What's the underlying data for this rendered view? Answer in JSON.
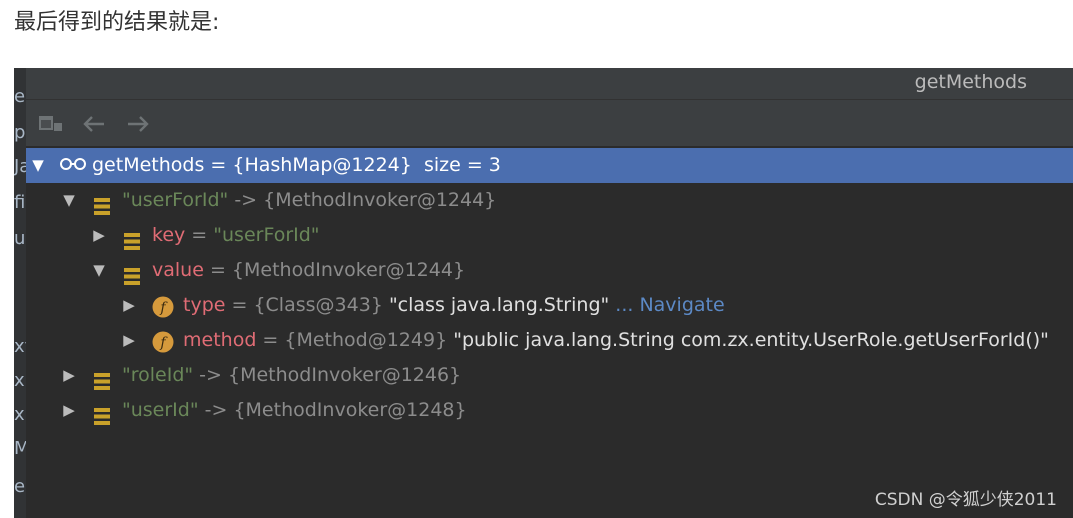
{
  "heading": "最后得到的结果就是:",
  "window": {
    "title": "getMethods"
  },
  "gutter_chars": [
    "e",
    "p",
    "Ja",
    "fi",
    "u",
    "xy",
    "x",
    "x",
    "M",
    "e"
  ],
  "tree": {
    "root": {
      "name": "getMethods",
      "eq": " = ",
      "value": "{HashMap@1224}",
      "size": "size = 3"
    },
    "entry1": {
      "key": "\"userForId\"",
      "arrow": " -> ",
      "value": "{MethodInvoker@1244}"
    },
    "key_row": {
      "name": "key",
      "eq": " = ",
      "value": "\"userForId\""
    },
    "value_row": {
      "name": "value",
      "eq": " = ",
      "value": "{MethodInvoker@1244}"
    },
    "type_row": {
      "name": "type",
      "eq": " = ",
      "ref": "{Class@343}",
      "value": "\"class java.lang.String\"",
      "nav": "... Navigate"
    },
    "method_row": {
      "name": "method",
      "eq": " = ",
      "ref": "{Method@1249}",
      "value": "\"public java.lang.String com.zx.entity.UserRole.getUserForId()\""
    },
    "entry2": {
      "key": "\"roleId\"",
      "arrow": " -> ",
      "value": "{MethodInvoker@1246}"
    },
    "entry3": {
      "key": "\"userId\"",
      "arrow": " -> ",
      "value": "{MethodInvoker@1248}"
    }
  },
  "watermark": "CSDN @令狐少侠2011",
  "colors": {
    "panel_bg": "#2b2b2b",
    "selection": "#4b6eaf",
    "string": "#6a8759",
    "field": "#e06c75",
    "navigate": "#5c89c5",
    "entry_icon": "#c9a12a",
    "field_icon": "#d69a3c"
  },
  "icons": [
    "restore-layout-icon",
    "back-arrow-icon",
    "forward-arrow-icon",
    "expand-triangle-icon",
    "collapse-triangle-icon",
    "watch-glasses-icon",
    "map-entry-icon",
    "field-f-icon"
  ]
}
